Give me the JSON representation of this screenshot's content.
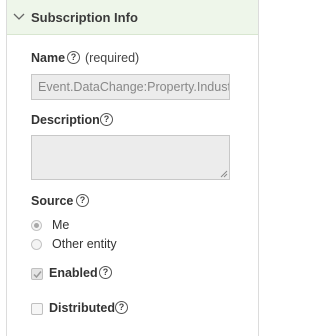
{
  "section": {
    "title": "Subscription Info",
    "expanded": true
  },
  "name_field": {
    "label": "Name",
    "required_text": "(required)",
    "value": "Event.DataChange:Property.Indust"
  },
  "description_field": {
    "label": "Description",
    "value": ""
  },
  "source_field": {
    "label": "Source",
    "options": [
      {
        "label": "Me",
        "selected": true
      },
      {
        "label": "Other entity",
        "selected": false
      }
    ]
  },
  "enabled": {
    "label": "Enabled",
    "checked": true,
    "disabled": true
  },
  "distributed": {
    "label": "Distributed",
    "checked": false
  },
  "help_icon": "?",
  "colors": {
    "header_bg": "#eef6ea",
    "input_bg": "#ececec",
    "text": "#333333"
  }
}
